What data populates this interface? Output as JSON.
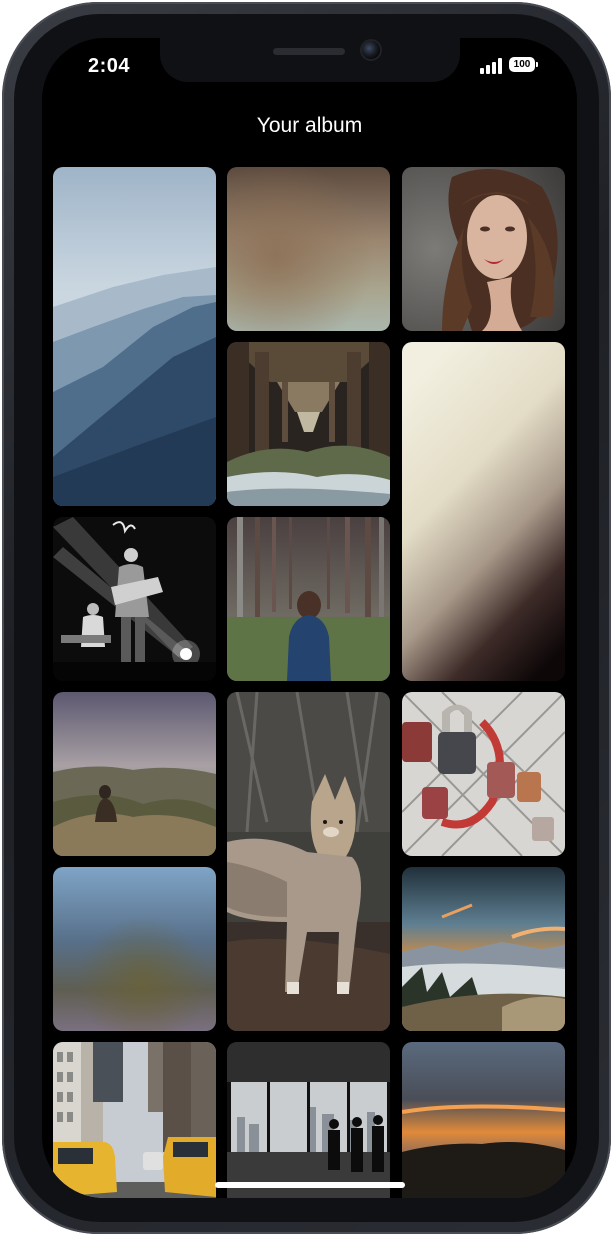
{
  "status_bar": {
    "time": "2:04",
    "battery": "100",
    "signal_icon": "cellular-signal-icon",
    "battery_icon": "battery-icon"
  },
  "header": {
    "title": "Your album"
  },
  "colors": {
    "background": "#000000",
    "text": "#ffffff",
    "frame": "#1e2026"
  },
  "album": {
    "photos": [
      {
        "name": "misty-mountains"
      },
      {
        "name": "blurred-brown-gradient"
      },
      {
        "name": "woman-portrait"
      },
      {
        "name": "under-pier"
      },
      {
        "name": "cream-gradient"
      },
      {
        "name": "concert-guitarist"
      },
      {
        "name": "girl-in-forest"
      },
      {
        "name": "person-on-cliff"
      },
      {
        "name": "coyote"
      },
      {
        "name": "love-padlocks"
      },
      {
        "name": "blurred-blue-gradient"
      },
      {
        "name": "snowy-valley-sunset"
      },
      {
        "name": "city-street-taxis"
      },
      {
        "name": "office-window-silhouettes"
      },
      {
        "name": "sunset-hills"
      }
    ]
  }
}
